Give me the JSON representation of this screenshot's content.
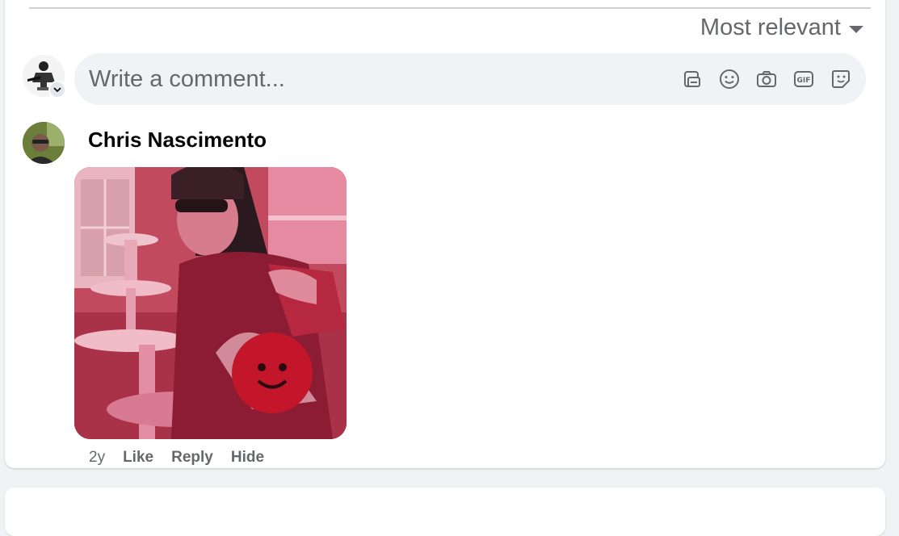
{
  "sort": {
    "label": "Most relevant"
  },
  "composer": {
    "placeholder": "Write a comment...",
    "tools": [
      "avatar-sticker-icon",
      "emoji-icon",
      "camera-icon",
      "gif-icon",
      "sticker-icon"
    ]
  },
  "comment": {
    "author": "Chris Nascimento",
    "timestamp": "2y",
    "like_label": "Like",
    "reply_label": "Reply",
    "hide_label": "Hide"
  },
  "colors": {
    "secondary_text": "#65676b",
    "input_bg": "#f0f2f5",
    "page_bg": "#f0f2f5"
  }
}
